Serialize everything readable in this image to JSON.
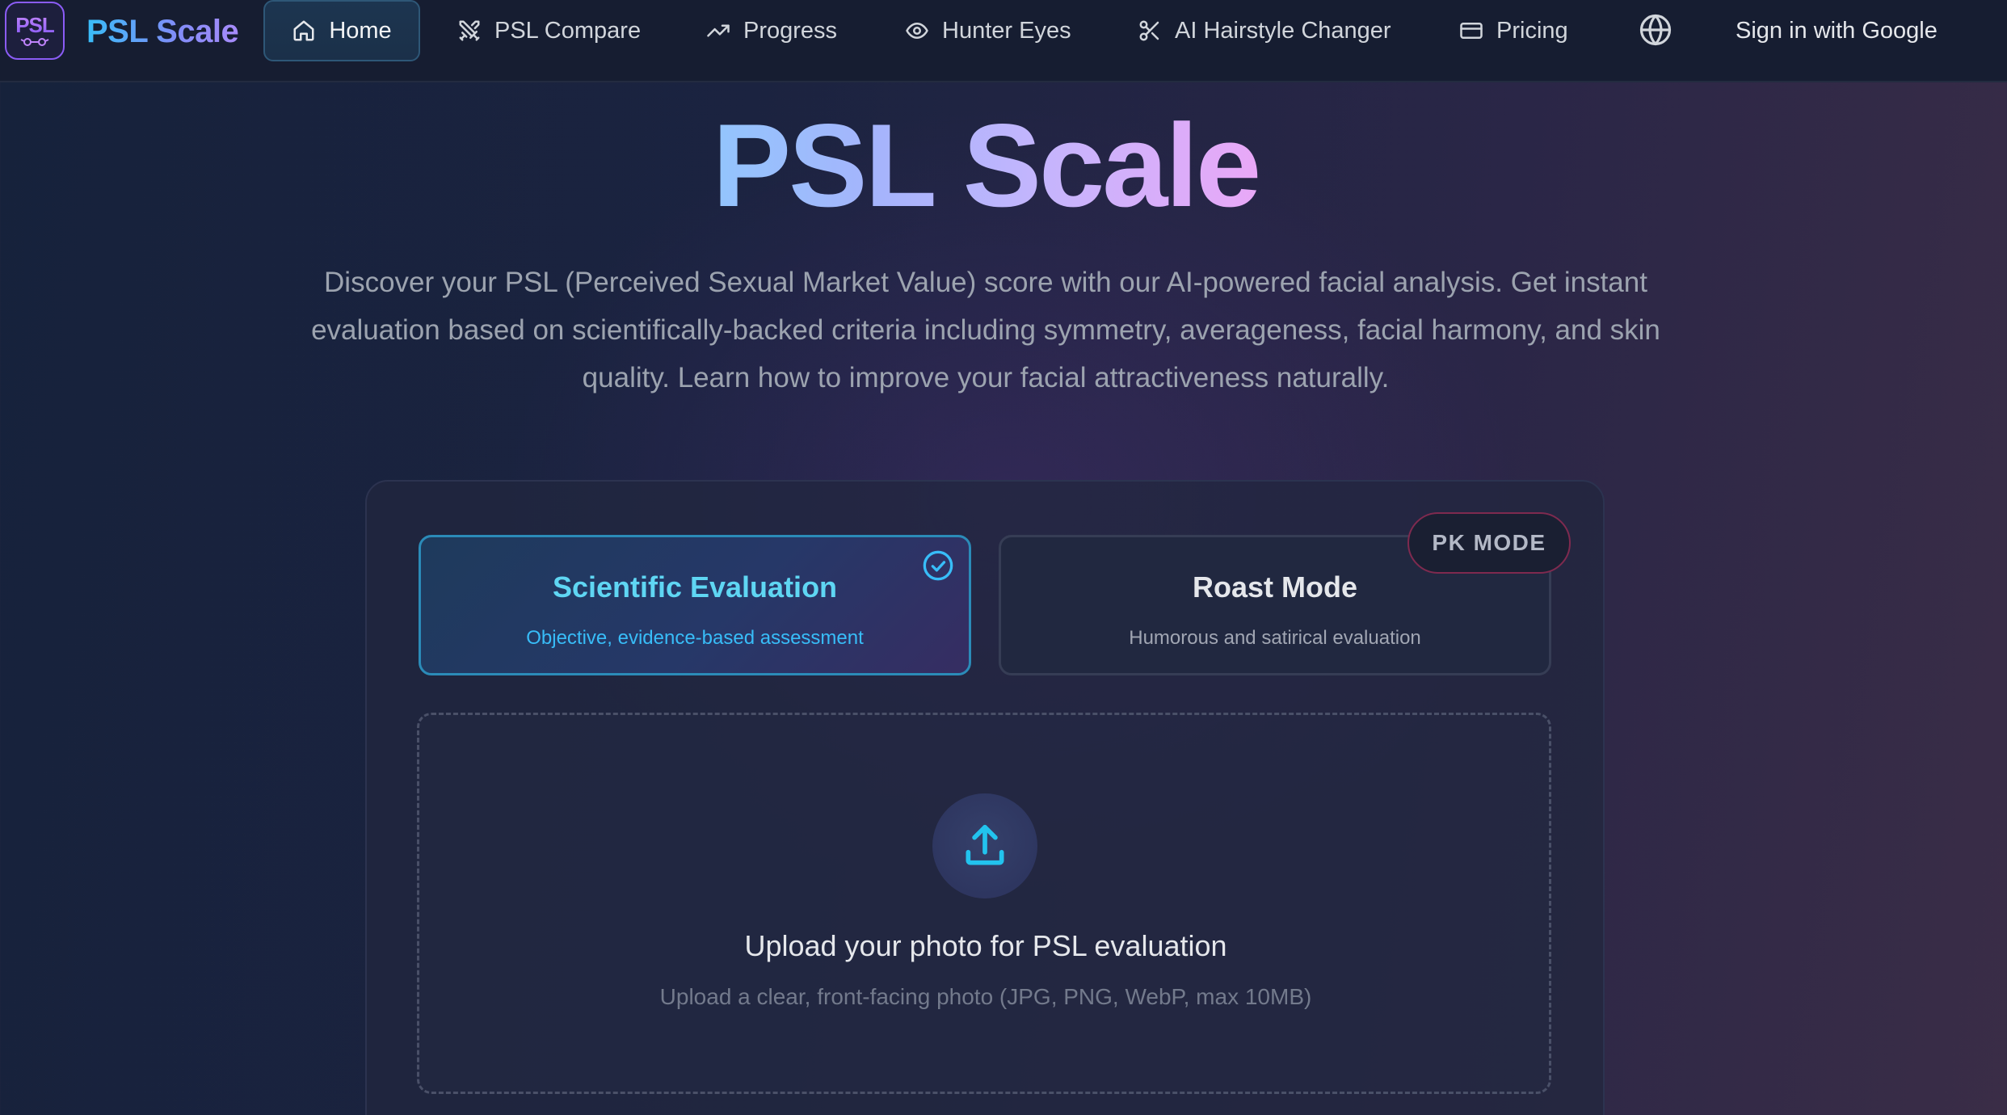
{
  "brand": {
    "logo_text": "PSL",
    "name": "PSL Scale"
  },
  "nav": {
    "items": [
      {
        "label": "Home",
        "icon": "home-icon",
        "active": true
      },
      {
        "label": "PSL Compare",
        "icon": "swords-icon"
      },
      {
        "label": "Progress",
        "icon": "trending-up-icon"
      },
      {
        "label": "Hunter Eyes",
        "icon": "eye-icon"
      },
      {
        "label": "AI Hairstyle Changer",
        "icon": "scissors-icon"
      },
      {
        "label": "Pricing",
        "icon": "credit-card-icon"
      }
    ],
    "language_icon": "globe-icon",
    "signin_label": "Sign in with Google"
  },
  "hero": {
    "title": "PSL Scale",
    "description": "Discover your PSL (Perceived Sexual Market Value) score with our AI-powered facial analysis. Get instant evaluation based on scientifically-backed criteria including symmetry, averageness, facial harmony, and skin quality. Learn how to improve your facial attractiveness naturally."
  },
  "modes": {
    "scientific": {
      "title": "Scientific Evaluation",
      "subtitle": "Objective, evidence-based assessment",
      "selected": true
    },
    "roast": {
      "title": "Roast Mode",
      "subtitle": "Humorous and satirical evaluation",
      "badge": "PK MODE"
    }
  },
  "upload": {
    "title": "Upload your photo for PSL evaluation",
    "subtitle": "Upload a clear, front-facing photo (JPG, PNG, WebP, max 10MB)"
  },
  "colors": {
    "accent_cyan": "#38bdf8",
    "accent_purple": "#a78bfa",
    "badge_border": "#7f2a4f"
  }
}
